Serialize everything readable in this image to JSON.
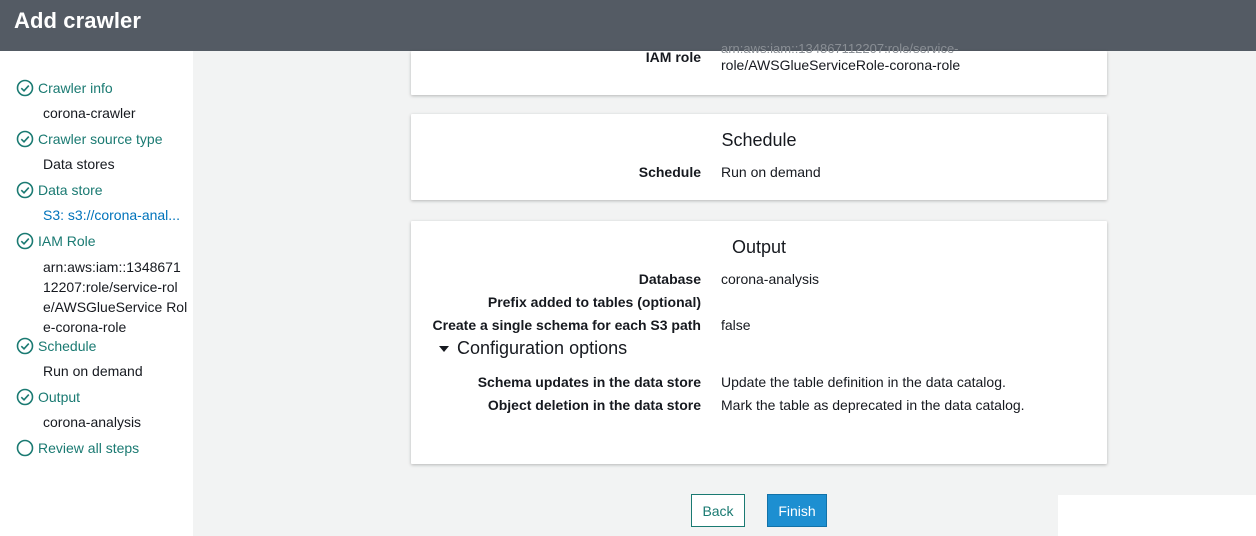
{
  "title": "Add crawler",
  "sidebar": {
    "steps": [
      {
        "label": "Crawler info",
        "value": "corona-crawler"
      },
      {
        "label": "Crawler source type",
        "value": "Data stores"
      },
      {
        "label": "Data store",
        "value": "S3: s3://corona-anal..."
      },
      {
        "label": "IAM Role",
        "value": "arn:aws:iam::1348671 12207:role/service-role/AWSGlueService Role-corona-role"
      },
      {
        "label": "Schedule",
        "value": "Run on demand"
      },
      {
        "label": "Output",
        "value": "corona-analysis"
      },
      {
        "label": "Review all steps"
      }
    ]
  },
  "iam_card": {
    "key": "IAM role",
    "value_line1": "arn:aws:iam::134867112207:role/service-",
    "value_line2": "role/AWSGlueServiceRole-corona-role"
  },
  "schedule_card": {
    "heading": "Schedule",
    "key": "Schedule",
    "value": "Run on demand"
  },
  "output_card": {
    "heading": "Output",
    "rows": [
      {
        "key": "Database",
        "value": "corona-analysis"
      },
      {
        "key": "Prefix added to tables (optional)",
        "value": ""
      },
      {
        "key": "Create a single schema for each S3 path",
        "value": "false"
      }
    ],
    "config_label": "Configuration options",
    "config_rows": [
      {
        "key": "Schema updates in the data store",
        "value": "Update the table definition in the data catalog."
      },
      {
        "key": "Object deletion in the data store",
        "value": "Mark the table as deprecated in the data catalog."
      }
    ]
  },
  "buttons": {
    "back": "Back",
    "finish": "Finish"
  },
  "colors": {
    "titlebar": "#545b64",
    "step_link": "#1a7a72",
    "finish_button": "#1d8fd1"
  }
}
